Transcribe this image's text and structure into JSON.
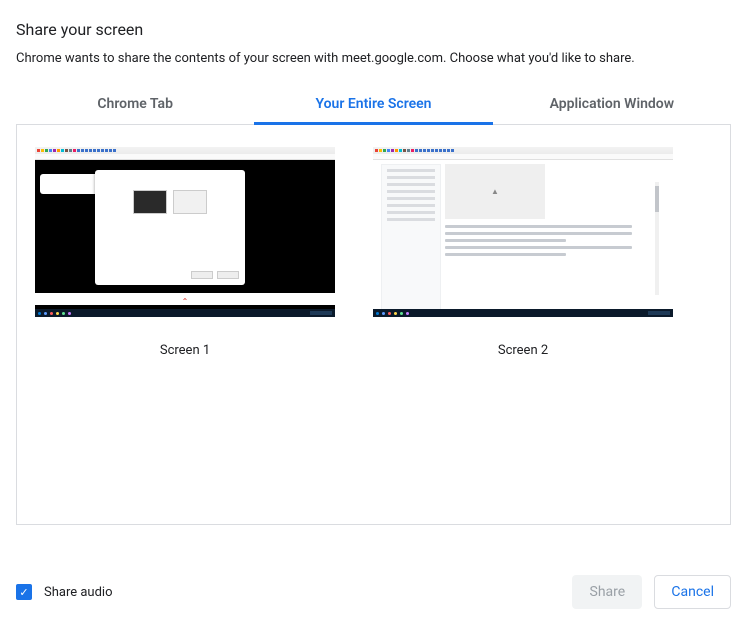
{
  "dialog": {
    "title": "Share your screen",
    "subtitle": "Chrome wants to share the contents of your screen with meet.google.com. Choose what you'd like to share."
  },
  "tabs": {
    "chrome_tab": "Chrome Tab",
    "entire_screen": "Your Entire Screen",
    "app_window": "Application Window",
    "active": "entire_screen"
  },
  "screens": [
    {
      "label": "Screen 1"
    },
    {
      "label": "Screen 2"
    }
  ],
  "share_audio": {
    "label": "Share audio",
    "checked": true
  },
  "buttons": {
    "share": "Share",
    "cancel": "Cancel",
    "share_enabled": false
  },
  "colors": {
    "accent": "#1a73e8",
    "border": "#dadce0",
    "muted_text": "#5f6368"
  }
}
